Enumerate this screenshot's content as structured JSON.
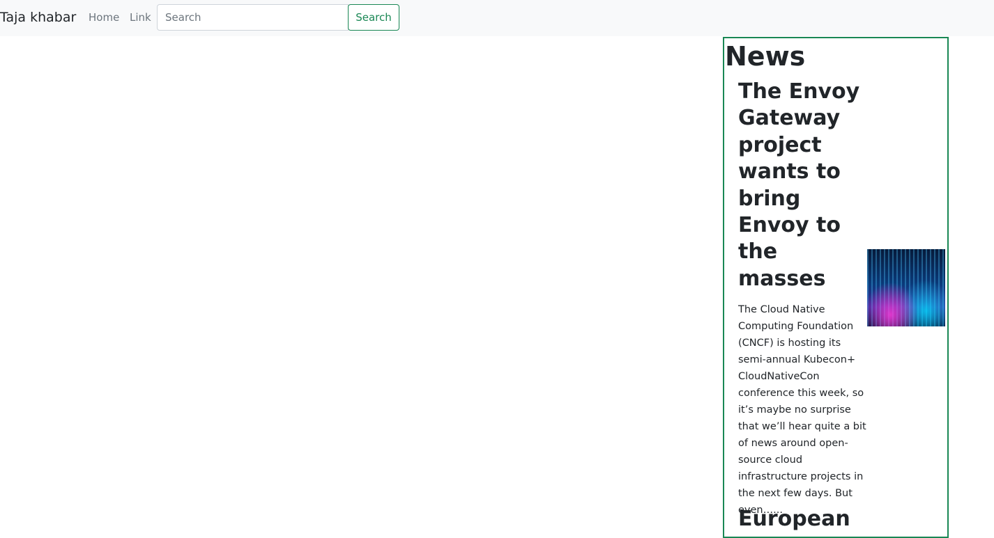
{
  "navbar": {
    "brand": "Taja khabar",
    "links": [
      "Home",
      "Link"
    ],
    "search_placeholder": "Search",
    "search_value": "",
    "search_button": "Search"
  },
  "sidebar": {
    "heading": "News",
    "articles": [
      {
        "title": "The Envoy Gateway project wants to bring Envoy to the masses",
        "description": "The Cloud Native Computing Foundation (CNCF) is hosting its semi-annual Kubecon+ CloudNativeCon conference this week, so it’s maybe no surprise that we’ll hear quite a bit of news around open-source cloud infrastructure projects in the next few days. But even…...",
        "thumbnail": "abstract-neon-lights-image"
      },
      {
        "title": "European"
      }
    ]
  },
  "colors": {
    "accent": "#198754",
    "navbar_bg": "#f8f9fa",
    "text": "#212529",
    "muted": "#6c757d"
  }
}
